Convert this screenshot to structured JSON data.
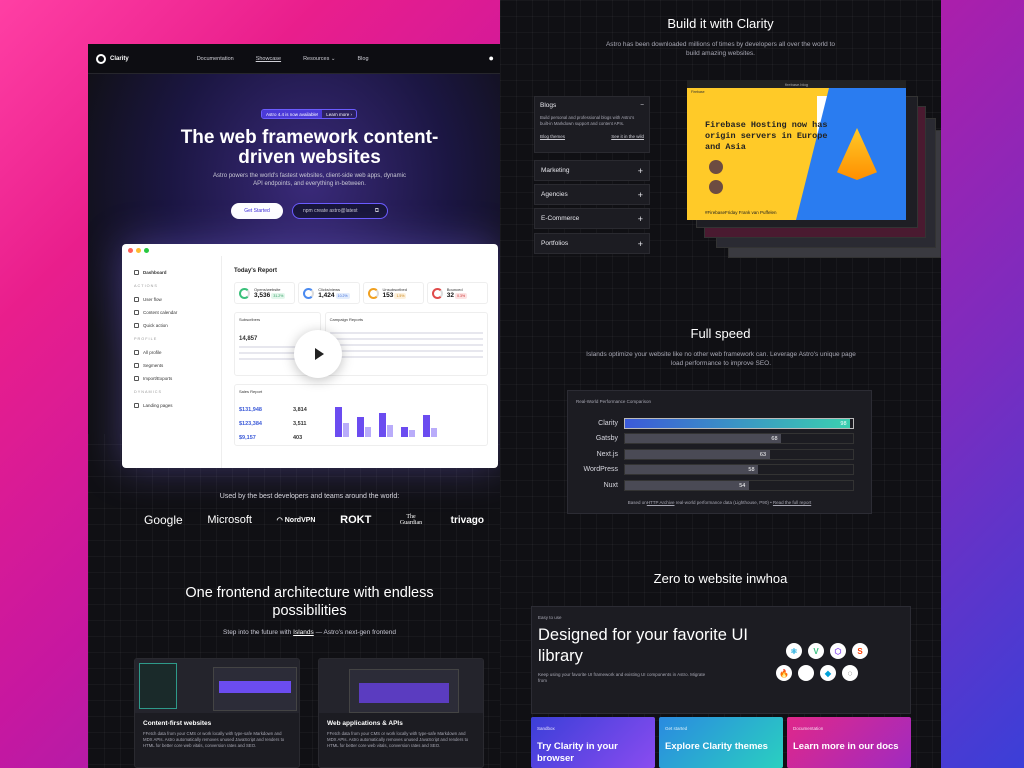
{
  "nav": {
    "brand": "Clarity",
    "links": [
      "Documentation",
      "Showcase",
      "Resources",
      "Blog"
    ]
  },
  "hero": {
    "badge_label": "Astro 4.4 is now available!",
    "badge_link": "Learn more",
    "title": "The web framework content-driven websites",
    "subtitle": "Astro powers the world's fastest websites, client-side web apps, dynamic API endpoints, and everything in-between.",
    "cta": "Get Started",
    "command": "npm create astro@latest"
  },
  "dashboard": {
    "sidebar": {
      "top": "Dashboard",
      "sec_actions": "ACTIONS",
      "actions": [
        "User flow",
        "Content calendar",
        "Quick action"
      ],
      "sec_profile": "PROFILE",
      "profile": [
        "All profile",
        "Segments",
        "Import/Exports"
      ],
      "sec_dynamics": "DYNAMICS",
      "dynamics": [
        "Landing pages"
      ]
    },
    "report_title": "Today's Report",
    "stats": [
      {
        "label": "Opens/website",
        "value": "3,536",
        "pct": "31.2%"
      },
      {
        "label": "Clicks/views",
        "value": "1,424",
        "pct": "10.2%"
      },
      {
        "label": "Unsubscribed",
        "value": "153",
        "pct": "1.5%"
      },
      {
        "label": "Bounced",
        "value": "32",
        "pct": "0.3%"
      }
    ],
    "card1": {
      "title": "Subscribers",
      "value": "14,857"
    },
    "card2": {
      "title": "Campaign Reports"
    },
    "sales": {
      "title": "Sales Report",
      "v1": "$131,948",
      "v2": "$123,384",
      "v3": "$9,157",
      "s1": "3,814",
      "s2": "3,511",
      "s3": "403"
    }
  },
  "used_by": "Used by the best developers and teams around the world:",
  "logos": [
    "Google",
    "Microsoft",
    "NordVPN",
    "ROKT",
    "The Guardian",
    "trivago"
  ],
  "architecture": {
    "title": "One frontend architecture with endless possibilities",
    "subtitle_pre": "Step into the future with",
    "subtitle_link": "Islands",
    "subtitle_post": "— Astro's next-gen frontend"
  },
  "features": [
    {
      "title": "Content-first websites",
      "desc": "FFetch data from your CMS or work locally with type-safe Markdown and MDX APIs. Astro automatically removes unused JavaScript and renders to HTML for better core web vitals, conversion rates and SEO."
    },
    {
      "title": "Web applications & APIs",
      "desc": "FFetch data from your CMS or work locally with type-safe Markdown and MDX APIs. Astro automatically removes unused JavaScript and renders to HTML for better core web vitals, conversion rates and SEO."
    }
  ],
  "build": {
    "title": "Build it with Clarity",
    "subtitle": "Astro has been downloaded millions of times by developers all over the world to build amazing websites."
  },
  "accordion": {
    "open": {
      "label": "Blogs",
      "desc": "Build personal and professional blogs with Astro's built-in Markdown support and content APIs.",
      "link1": "Blog themes",
      "link2": "See it in the wild"
    },
    "items": [
      "Marketing",
      "Agencies",
      "E-Commerce",
      "Portfolios"
    ]
  },
  "showcase": {
    "tab": "firebase.blog",
    "header": "Firebase",
    "title": "Firebase Hosting now has origin servers in Europe and Asia",
    "caption": "#FirebaseFriday Frank van Puffelen"
  },
  "speed": {
    "title": "Full speed",
    "subtitle": "Islands optimize your website like no other web framework can. Leverage Astro's unique page load performance to improve  SEO."
  },
  "chart_data": {
    "type": "bar",
    "title": "Real-World Performance Comparison",
    "categories": [
      "Clarity",
      "Gatsby",
      "Next.js",
      "WordPress",
      "Nuxt"
    ],
    "values": [
      98,
      68,
      63,
      58,
      54
    ]
  },
  "perf_footer": {
    "pre": "Based on",
    "link1": "HTTP Archive",
    "mid": "real-world performance data (Lighthouse, P90) •",
    "link2": "Read the full report"
  },
  "zero": {
    "title": "Zero to website inwhoa"
  },
  "ui": {
    "tag": "Easy to use",
    "title": "Designed for your favorite UI library",
    "desc": "Keep using your favorite UI framework and existing UI components in Astro. Migrate from"
  },
  "mini": [
    {
      "tag": "Sandbox",
      "title": "Try Clarity in your browser"
    },
    {
      "tag": "Get started",
      "title": "Explore Clarity themes"
    },
    {
      "tag": "Documentation",
      "title": "Learn more in our docs"
    }
  ],
  "colors": {
    "accent": "#6b4cf0",
    "clarity_bar": "#3ac0c0"
  }
}
